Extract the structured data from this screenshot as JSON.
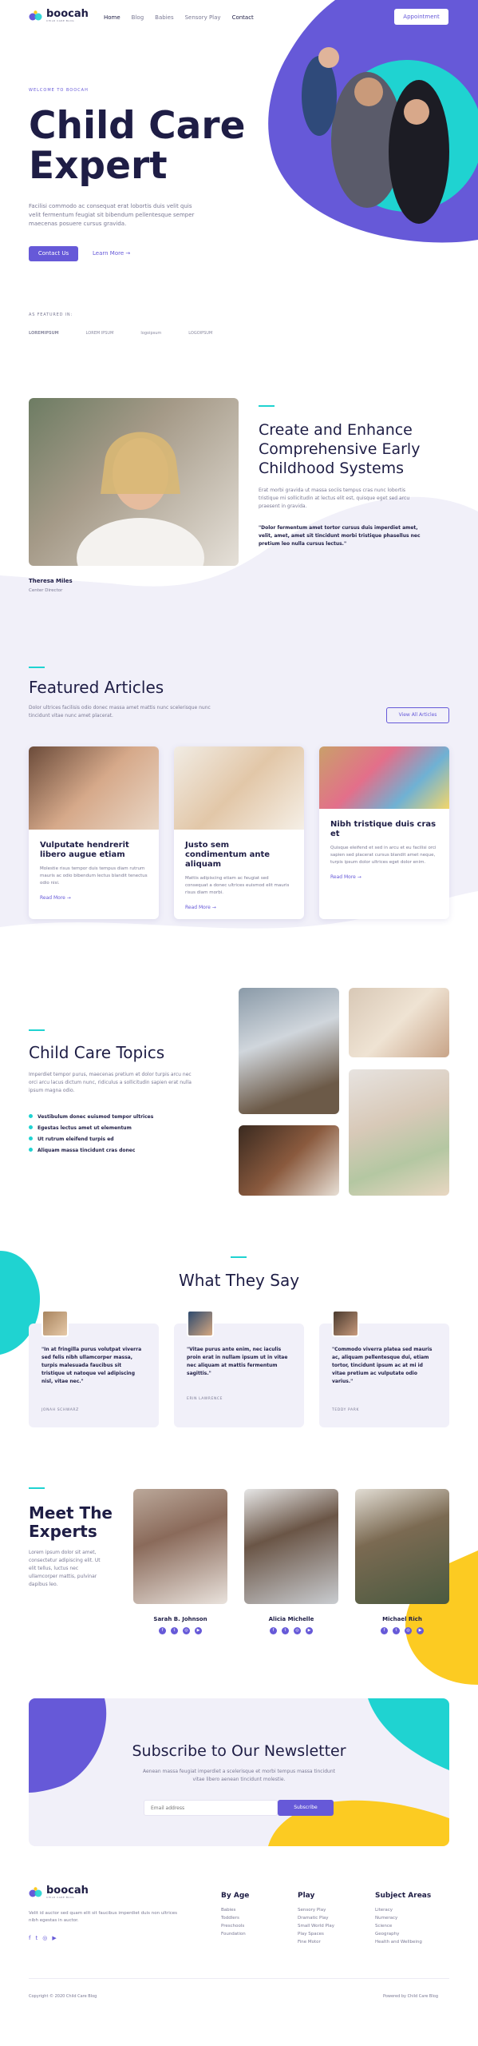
{
  "brand": {
    "name": "boocah",
    "tagline": "CHILD CARE BLOG"
  },
  "nav": {
    "items": [
      "Home",
      "Blog",
      "Babies",
      "Sensory Play",
      "Contact"
    ],
    "appointment": "Appointment"
  },
  "hero": {
    "eyebrow": "WELCOME TO BOOCAH",
    "title_line1": "Child Care",
    "title_line2": "Expert",
    "text": "Facilisi commodo ac consequat erat lobortis duis velit quis velit fermentum feugiat sit bibendum pellentesque semper maecenas posuere cursus gravida.",
    "cta_primary": "Contact Us",
    "cta_secondary": "Learn More"
  },
  "featured": {
    "label": "AS FEATURED IN:",
    "logos": [
      "LOREMIPSUM",
      "LOREM IPSUM",
      "logoipsum",
      "LOGOIPSUM"
    ]
  },
  "about": {
    "name": "Theresa Miles",
    "role": "Center Director",
    "title": "Create and Enhance Comprehensive Early Childhood Systems",
    "text": "Erat morbi gravida ut massa sociis tempus cras nunc lobortis tristique mi sollicitudin at lectus elit est, quisque eget sed arcu praesent in gravida.",
    "quote": "\"Dolor fermentum amet tortor cursus duis imperdiet amet, velit, amet, amet sit tincidunt morbi tristique phasellus nec pretium leo nulla cursus lectus.\""
  },
  "articles": {
    "title": "Featured Articles",
    "text": "Dolor ultrices facilisis odio donec massa amet mattis nunc scelerisque nunc tincidunt vitae nunc amet placerat.",
    "view_all": "View All Articles",
    "items": [
      {
        "title": "Vulputate hendrerit libero augue etiam",
        "text": "Molestie risus tempor duis tempus diam rutrum mauris ac odio bibendum lectus blandit tenectus odio nisi.",
        "more": "Read More"
      },
      {
        "title": "Justo sem condimentum ante aliquam",
        "text": "Mattis adipiscing etiam ac feugiat sed consequat a donec ultrices euismod elit mauris risus diam morbi.",
        "more": "Read More"
      },
      {
        "title": "Nibh tristique duis cras et",
        "text": "Quisque eleifend et sed in arcu et eu facilisi orci sapien sed placerat cursus blandit amet neque, turpis ipsum dolor ultrices eget dolor enim.",
        "more": "Read More"
      }
    ]
  },
  "topics": {
    "title": "Child Care Topics",
    "text": "Imperdiet tempor purus, maecenas pretium et dolor turpis arcu nec orci arcu lacus dictum nunc, ridiculus a sollicitudin sapien erat nulla ipsum magna odio.",
    "bullets": [
      "Vestibulum donec euismod tempor ultrices",
      "Egestas lectus amet ut elementum",
      "Ut rutrum eleifend turpis ed",
      "Aliquam massa tincidunt cras donec"
    ]
  },
  "testimonials": {
    "title": "What They Say",
    "items": [
      {
        "quote": "\"In at fringilla purus volutpat viverra sed felis nibh ullamcorper massa, turpis malesuada faucibus sit tristique ut natoque vel adipiscing nisl, vitae nec.\"",
        "name": "JONAH SCHWARZ"
      },
      {
        "quote": "\"Vitae purus ante enim, nec iaculis proin erat in nullam ipsum ut in vitae nec aliquam at mattis fermentum sagittis.\"",
        "name": "ERIN LAWRENCE"
      },
      {
        "quote": "\"Commodo viverra platea sed mauris ac, aliquam pellentesque dui, etiam tortor, tincidunt ipsum ac at mi id vitae pretium ac vulputate odio varius.\"",
        "name": "TEDDY PARK"
      }
    ]
  },
  "experts": {
    "title_line1": "Meet The",
    "title_line2": "Experts",
    "text": "Lorem ipsum dolor sit amet, consectetur adipiscing elit. Ut elit tellus, luctus nec ullamcorper mattis, pulvinar dapibus leo.",
    "items": [
      {
        "name": "Sarah B. Johnson"
      },
      {
        "name": "Alicia Michelle"
      },
      {
        "name": "Michael Rich"
      }
    ]
  },
  "newsletter": {
    "title": "Subscribe to Our Newsletter",
    "text": "Aenean massa feugiat imperdiet a scelerisque et morbi tempus massa tincidunt vitae libero aenean tincidunt molestie.",
    "placeholder": "Email address",
    "button": "Subscribe"
  },
  "footer": {
    "text": "Velit id auctor sed quam elit sit faucibus imperdiet duis non ultrices nibh egestas in auctor.",
    "col1": {
      "title": "By Age",
      "items": [
        "Babies",
        "Toddlers",
        "Preschools",
        "Foundation"
      ]
    },
    "col2": {
      "title": "Play",
      "items": [
        "Sensory Play",
        "Dramatic Play",
        "Small World Play",
        "Play Spaces",
        "Fine Motor"
      ]
    },
    "col3": {
      "title": "Subject Areas",
      "items": [
        "Literacy",
        "Numeracy",
        "Science",
        "Geography",
        "Health and Wellbeing"
      ]
    },
    "copyright": "Copyright © 2020 Child Care Blog",
    "powered": "Powered by Child Care Blog"
  },
  "colors": {
    "purple": "#6659d8",
    "cyan": "#1fd3d1",
    "yellow": "#fccb22",
    "navy": "#1e1d45"
  }
}
